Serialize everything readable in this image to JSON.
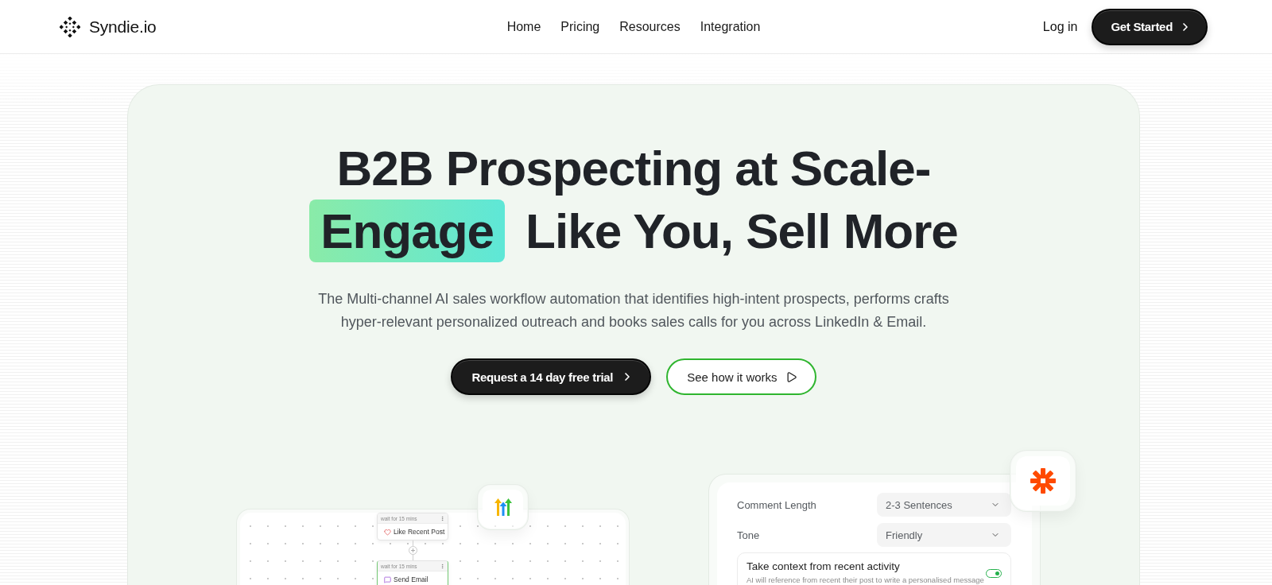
{
  "header": {
    "brand": "Syndie.io",
    "nav": [
      {
        "label": "Home"
      },
      {
        "label": "Pricing"
      },
      {
        "label": "Resources"
      },
      {
        "label": "Integration"
      }
    ],
    "login": "Log in",
    "cta": "Get Started"
  },
  "hero": {
    "title": "B2B Prospecting at Scale-",
    "highlight": "Engage",
    "title_rest": "Like You, Sell More",
    "subtitle": "The Multi-channel AI sales workflow automation that identifies high-intent prospects, performs crafts hyper-relevant personalized outreach and books sales calls for you across LinkedIn & Email.",
    "buttons": [
      {
        "kind": "primary",
        "label": "Request a 14 day free trial"
      },
      {
        "kind": "secondary",
        "label": "See how it works"
      }
    ]
  },
  "workflow": {
    "nodes": [
      {
        "kind": "like",
        "wait": "wait for 15 mins",
        "action": "Like Recent Post",
        "selected": false
      },
      {
        "kind": "email",
        "wait": "wait for 15 mins",
        "action": "Send Email",
        "selected": true
      }
    ]
  },
  "settings": {
    "fields": [
      {
        "label": "Comment Length",
        "value": "2-3 Sentences"
      },
      {
        "label": "Tone",
        "value": "Friendly"
      }
    ],
    "toggle": {
      "title": "Take context from recent activity",
      "description": "AI will reference from recent their post to write a personalised message",
      "on": true
    }
  }
}
